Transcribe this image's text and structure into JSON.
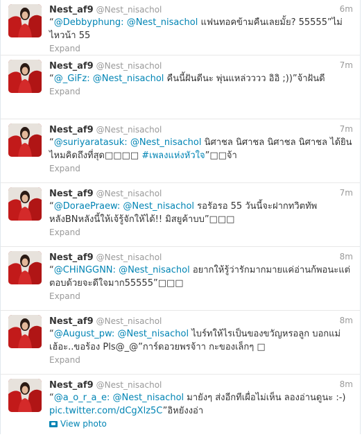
{
  "colors": {
    "link": "#0084b4",
    "meta": "#999999",
    "text": "#333333"
  },
  "icons": {
    "avatar": "profile-photo",
    "photo": "photo-icon"
  },
  "tweets": [
    {
      "name": "Nest_af9",
      "handle": "@Nest_nisachol",
      "time": "6m",
      "quote_open": "“",
      "mention1": "@Debbyphung:",
      "mention2": "@Nest_nisachol",
      "body": " แฟนทอคข้ามคืนเลยมั้ย? 55555”ไม่ไหวน้า 55",
      "action": "Expand"
    },
    {
      "name": "Nest_af9",
      "handle": "@Nest_nisachol",
      "time": "7m",
      "quote_open": "“",
      "mention1": "@_GiFz:",
      "mention2": "@Nest_nisachol",
      "body": " คืนนี้ฝันดีนะ พุ่นแหล่วววว อิอิ ;))”จ้าฝันดี",
      "action": "Expand"
    },
    {
      "name": "Nest_af9",
      "handle": "@Nest_nisachol",
      "time": "7m",
      "quote_open": "“",
      "mention1": "@suriyaratasuk:",
      "mention2": "@Nest_nisachol",
      "body": " นิศาชล นิศาชล นิศาชล นิศาชล ได้ยินไหมคิดถึงที่สุด□□□□ ",
      "hashtag": "#เพลงแห่งหัวใจ",
      "body_tail": "”□□จ้า",
      "action": "Expand"
    },
    {
      "name": "Nest_af9",
      "handle": "@Nest_nisachol",
      "time": "7m",
      "quote_open": "“",
      "mention1": "@DoraePraew:",
      "mention2": "@Nest_nisachol",
      "body": " รอรัอรอ 55 วันนี้จะฝากทวิตทัพหลังBNหลังนี้ให้เจ้รู้จักให้ได้!! มิสยูค้าบบ”□□□",
      "action": "Expand"
    },
    {
      "name": "Nest_af9",
      "handle": "@Nest_nisachol",
      "time": "8m",
      "quote_open": "“",
      "mention1": "@CHiNGGNN:",
      "mention2": "@Nest_nisachol",
      "body": " อยากให้รู้ว่ารักมากมายแค่อ่านก้พอนะแต่ตอบด้วยจะดีใจมาก55555”□□□",
      "action": "Expand"
    },
    {
      "name": "Nest_af9",
      "handle": "@Nest_nisachol",
      "time": "8m",
      "quote_open": "“",
      "mention1": "@August_pw:",
      "mention2": "@Nest_nisachol",
      "body": " ไบร์ทให้ไรเป็นของขวัญหรอลูก บอกแม่เฮ้อะ..ขอร้อง Pls@_@”การ์ดอวยพรจ้าา กะของเล็กๆ □",
      "action": "Expand"
    },
    {
      "name": "Nest_af9",
      "handle": "@Nest_nisachol",
      "time": "8m",
      "quote_open": "“",
      "mention1": "@a_o_r_a_e:",
      "mention2": "@Nest_nisachol",
      "body": " มายังๆ ส่งอีกทีเผื่อไม่เห็น ลองอ่านดูนะ :-) ",
      "link": "pic.twitter.com/dCgXlz5C",
      "body_tail": "”อิหยังงอ่า",
      "action": "View photo"
    }
  ]
}
